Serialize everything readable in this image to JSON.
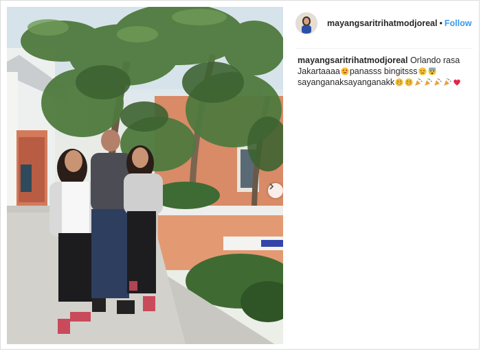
{
  "post": {
    "username": "mayangsaritrihatmodjoreal",
    "separator": "•",
    "follow_label": "Follow",
    "caption": {
      "username": "mayangsaritrihatmodjoreal",
      "line1_a": "Orlando rasa",
      "line2_a": "Jakartaaaa",
      "line2_b": "panasss bingitsss",
      "line3_a": "sayanganaksayanganakk"
    }
  },
  "icons": {
    "next": "chevron-right-icon",
    "emojis": [
      "heart-eyes",
      "sweat-face",
      "scared-face",
      "grin",
      "grin",
      "party-popper",
      "party-popper",
      "party-popper",
      "party-popper",
      "red-heart"
    ]
  },
  "colors": {
    "follow": "#3897f0",
    "text": "#262626",
    "border": "#dbdbdb"
  }
}
